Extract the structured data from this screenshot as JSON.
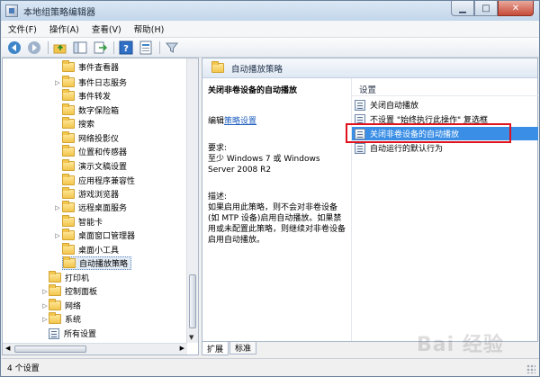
{
  "window": {
    "title": "本地组策略编辑器",
    "controls": {
      "minimize": "▁",
      "maximize": "□",
      "close": "✕"
    }
  },
  "menu": [
    "文件(F)",
    "操作(A)",
    "查看(V)",
    "帮助(H)"
  ],
  "toolbar": {
    "icons": [
      "back-arrow-icon",
      "forward-arrow-icon",
      "folder-up-icon",
      "show-hide-tree-icon",
      "export-list-icon",
      "help-icon",
      "properties-icon",
      "filter-icon"
    ]
  },
  "tree": {
    "items": [
      {
        "label": "事件查看器",
        "expandable": false,
        "indent": 2
      },
      {
        "label": "事件日志服务",
        "expandable": true,
        "indent": 2
      },
      {
        "label": "事件转发",
        "expandable": false,
        "indent": 2
      },
      {
        "label": "数字保险箱",
        "expandable": false,
        "indent": 2
      },
      {
        "label": "搜索",
        "expandable": false,
        "indent": 2
      },
      {
        "label": "网络投影仪",
        "expandable": false,
        "indent": 2
      },
      {
        "label": "位置和传感器",
        "expandable": false,
        "indent": 2
      },
      {
        "label": "演示文稿设置",
        "expandable": false,
        "indent": 2
      },
      {
        "label": "应用程序兼容性",
        "expandable": false,
        "indent": 2
      },
      {
        "label": "游戏浏览器",
        "expandable": false,
        "indent": 2
      },
      {
        "label": "远程桌面服务",
        "expandable": true,
        "indent": 2
      },
      {
        "label": "智能卡",
        "expandable": false,
        "indent": 2
      },
      {
        "label": "桌面窗口管理器",
        "expandable": true,
        "indent": 2
      },
      {
        "label": "桌面小工具",
        "expandable": false,
        "indent": 2
      },
      {
        "label": "自动播放策略",
        "expandable": false,
        "indent": 2,
        "selected": true
      },
      {
        "label": "打印机",
        "expandable": false,
        "indent": 1
      },
      {
        "label": "控制面板",
        "expandable": true,
        "indent": 1
      },
      {
        "label": "网络",
        "expandable": true,
        "indent": 1
      },
      {
        "label": "系统",
        "expandable": true,
        "indent": 1
      },
      {
        "label": "所有设置",
        "expandable": false,
        "indent": 1,
        "settings": true
      }
    ]
  },
  "right": {
    "header": "自动播放策略",
    "description": {
      "title": "关闭非卷设备的自动播放",
      "edit_prefix": "编辑",
      "edit_link": "策略设置",
      "requirements_label": "要求:",
      "requirements_text": "至少 Windows 7 或 Windows Server 2008 R2",
      "description_label": "描述:",
      "description_text": "如果启用此策略，则不会对非卷设备(如 MTP 设备)启用自动播放。如果禁用或未配置此策略，则继续对非卷设备启用自动播放。"
    },
    "list": {
      "column": "设置",
      "rows": [
        {
          "label": "关闭自动播放",
          "selected": false
        },
        {
          "label": "不设置 \"始终执行此操作\" 复选框",
          "selected": false
        },
        {
          "label": "关闭非卷设备的自动播放",
          "selected": true
        },
        {
          "label": "自动运行的默认行为",
          "selected": false
        }
      ]
    }
  },
  "tabs": [
    "扩展",
    "标准"
  ],
  "status": "4 个设置",
  "watermark": "Bai 经验"
}
